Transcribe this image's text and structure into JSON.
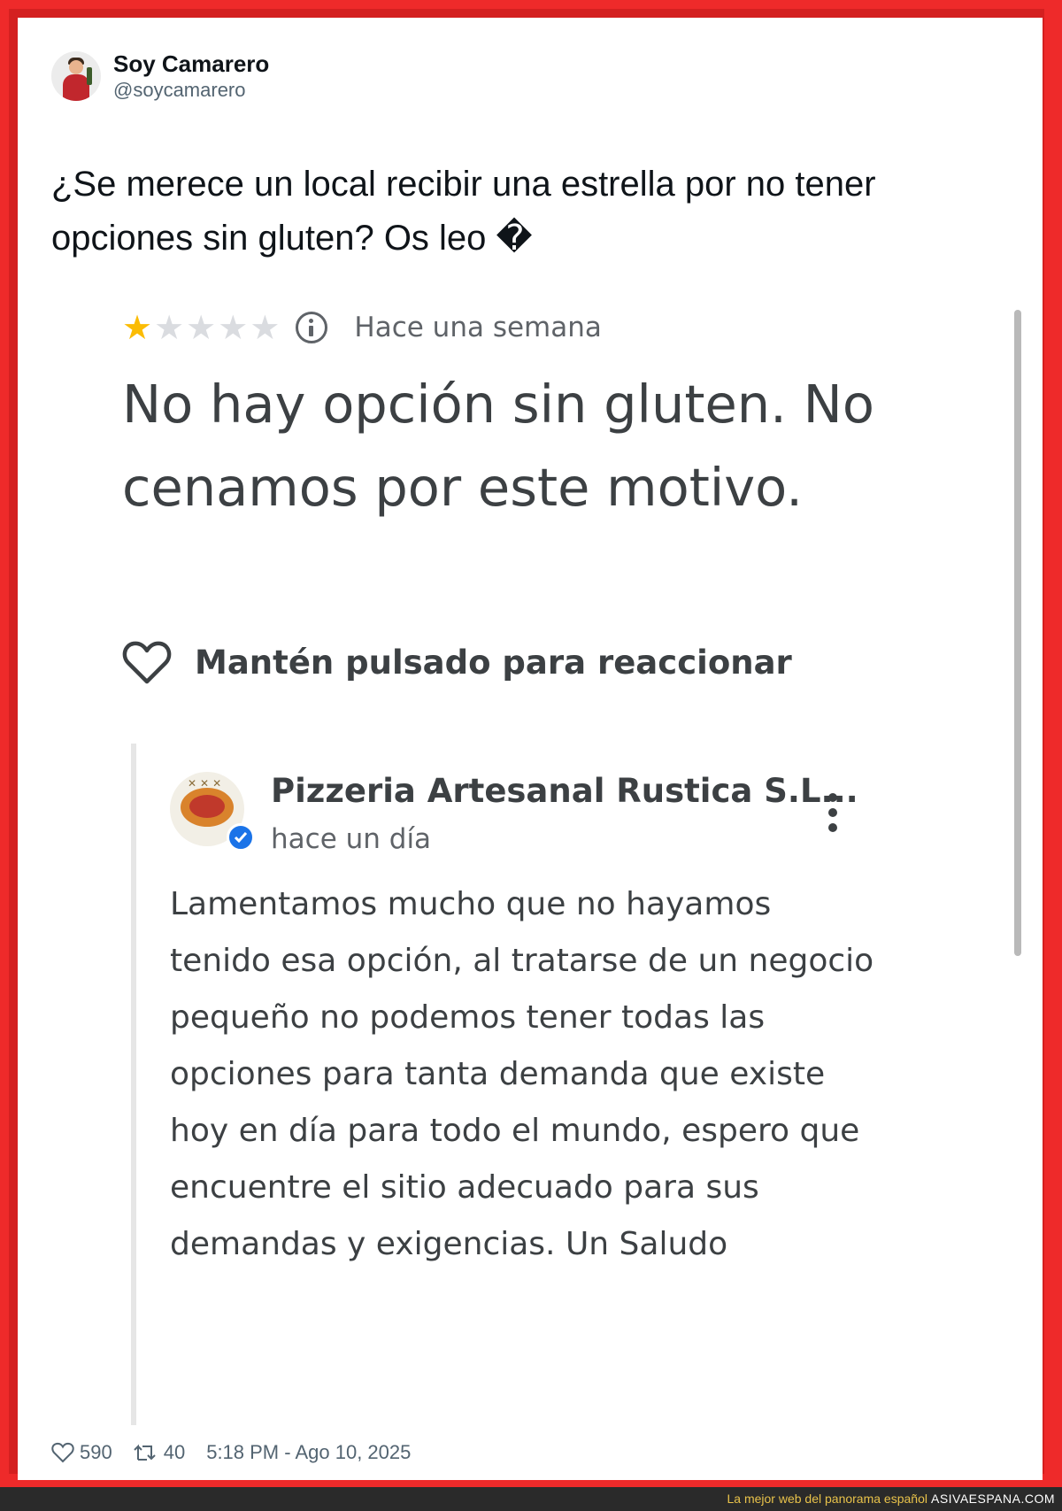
{
  "tweet": {
    "author_name": "Soy Camarero",
    "author_handle": "@soycamarero",
    "text": "¿Se merece un local recibir una estrella por no tener opciones sin gluten? Os leo �",
    "likes": "590",
    "retweets": "40",
    "timestamp": "5:18 PM - Ago 10, 2025"
  },
  "review": {
    "rating": 1,
    "max_rating": 5,
    "time_ago": "Hace una semana",
    "text": "No hay opción sin gluten. No cenamos por este motivo.",
    "react_label": "Mantén pulsado para reaccionar"
  },
  "owner_reply": {
    "business_name": "Pizzeria Artesanal Rustica S.L...",
    "time_ago": "hace un día",
    "text": "Lamentamos mucho que no hayamos tenido esa opción, al tratarse de un negocio pequeño no podemos tener todas las opciones para tanta demanda que existe hoy en día para todo el mundo, espero que encuentre el sitio adecuado para sus demandas y exigencias. Un Saludo"
  },
  "footer": {
    "tagline": "La mejor web del panorama español",
    "site": "ASIVAESPANA.COM"
  },
  "colors": {
    "border_red": "#ee2a2a",
    "star_filled": "#fbbc04",
    "star_empty": "#dadce0",
    "verified_blue": "#1a73e8"
  },
  "icons": [
    "avatar",
    "star-icon",
    "info-icon",
    "heart-icon",
    "verified-badge-icon",
    "more-vert-icon",
    "retweet-icon"
  ]
}
